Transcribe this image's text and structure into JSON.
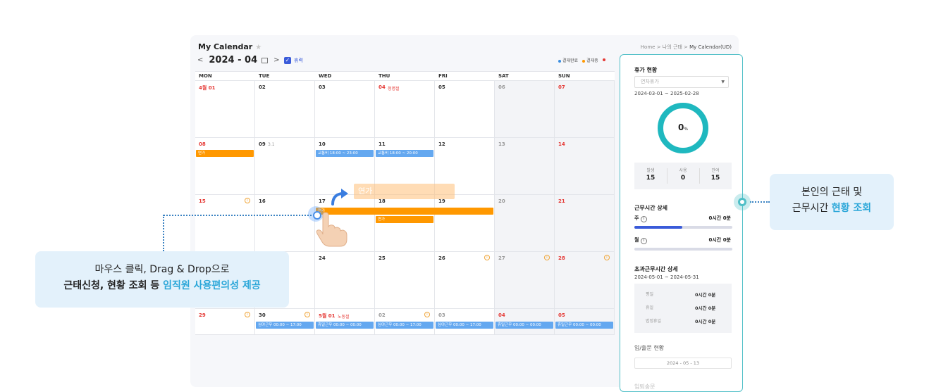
{
  "header": {
    "title": "My Calendar",
    "breadcrumb_home": "Home",
    "breadcrumb_sep1": ">",
    "breadcrumb_mid": "나의 근태",
    "breadcrumb_sep2": ">",
    "breadcrumb_current": "My Calendar(UD)",
    "month": "2024 - 04",
    "prev": "<",
    "next": ">",
    "holiday_checkbox_label": "휴력",
    "legend": [
      {
        "label": "결재완료",
        "color": "#3a8de0"
      },
      {
        "label": "결재중",
        "color": "#ff9800"
      }
    ]
  },
  "weekdays": [
    "MON",
    "TUE",
    "WED",
    "THU",
    "FRI",
    "SAT",
    "SUN"
  ],
  "calendar": {
    "weeks": [
      [
        {
          "day": "4월 01",
          "color": "red"
        },
        {
          "day": "02"
        },
        {
          "day": "03"
        },
        {
          "day": "04",
          "color": "red",
          "holiday": "청명절"
        },
        {
          "day": "05"
        },
        {
          "day": "06",
          "color": "gray"
        },
        {
          "day": "07",
          "color": "red"
        }
      ],
      [
        {
          "day": "08",
          "color": "red"
        },
        {
          "day": "09",
          "sub": "3.1"
        },
        {
          "day": "10"
        },
        {
          "day": "11"
        },
        {
          "day": "12"
        },
        {
          "day": "13",
          "color": "gray"
        },
        {
          "day": "14",
          "color": "red"
        }
      ],
      [
        {
          "day": "15",
          "color": "red"
        },
        {
          "day": "16"
        },
        {
          "day": "17"
        },
        {
          "day": "18"
        },
        {
          "day": "19"
        },
        {
          "day": "20",
          "color": "gray"
        },
        {
          "day": "21",
          "color": "red"
        }
      ],
      [
        {
          "day": ""
        },
        {
          "day": ""
        },
        {
          "day": "24"
        },
        {
          "day": "25"
        },
        {
          "day": "26"
        },
        {
          "day": "27",
          "color": "gray"
        },
        {
          "day": "28",
          "color": "red"
        }
      ],
      [
        {
          "day": "29",
          "color": "red"
        },
        {
          "day": "30"
        },
        {
          "day": "5월 01",
          "color": "red",
          "holiday": "노동절"
        },
        {
          "day": "02",
          "color": "gray"
        },
        {
          "day": "03",
          "color": "gray"
        },
        {
          "day": "04",
          "color": "red"
        },
        {
          "day": "05",
          "color": "red"
        }
      ]
    ],
    "events": {
      "w2_mon": "연가",
      "w2_wed": "교통비 18:00 ~ 23:00",
      "w2_thu": "교통비 18:00 ~ 20:00",
      "w3_wed": "연가",
      "w3_thu": "연가",
      "w5_tue": "심야근무 00:00 ~ 17:00",
      "w5_wed": "휴일근무 00:00 ~ 00:00",
      "w5_thu": "심야근무 00:00 ~ 17:00",
      "w5_fri": "심야근무 00:00 ~ 17:00",
      "w5_sat": "휴일근무 00:00 ~ 00:00",
      "w5_sun": "휴일근무 00:00 ~ 00:00"
    },
    "drag_label": "연가"
  },
  "panel": {
    "leave_title": "휴가 현황",
    "leave_select": "연차휴가",
    "leave_period": "2024-03-01 ~ 2025-02-28",
    "usage_value": "0",
    "usage_unit": "%",
    "usage_fraction": 0,
    "stats": [
      {
        "label": "발생",
        "value": "15"
      },
      {
        "label": "사용",
        "value": "0"
      },
      {
        "label": "잔여",
        "value": "15"
      }
    ],
    "work_title": "근무시간 상세",
    "week_label": "주",
    "week_value": "0시간 0분",
    "week_fraction": 0.49,
    "month_label": "월",
    "month_value": "0시간 0분",
    "month_fraction": 0,
    "ot_title": "초과근무시간 상세",
    "ot_period": "2024-05-01 ~ 2024-05-31",
    "ot_rows": [
      {
        "label": "평일",
        "value": "0시간 0분"
      },
      {
        "label": "휴일",
        "value": "0시간 0분"
      },
      {
        "label": "법정휴일",
        "value": "0시간 0분"
      }
    ],
    "inout_title": "입/출문 현황",
    "inout_date": "2024 - 05 - 13",
    "faded_title": "입퇴송문"
  },
  "callouts": {
    "left_line1": "마우스 클릭, Drag & Drop으로",
    "left_line2_prefix": "근태신청, 현황 조회 등 ",
    "left_line2_highlight": "임직원 사용편의성 제공",
    "right_line1": "본인의 근태 및",
    "right_line2_prefix": "근무시간 ",
    "right_line2_highlight": "현황 조회"
  },
  "colors": {
    "accent_teal": "#4fbfc7",
    "event_orange": "#ff9800",
    "event_blue": "#64a8f0",
    "highlight_blue": "#2aa6d8"
  }
}
